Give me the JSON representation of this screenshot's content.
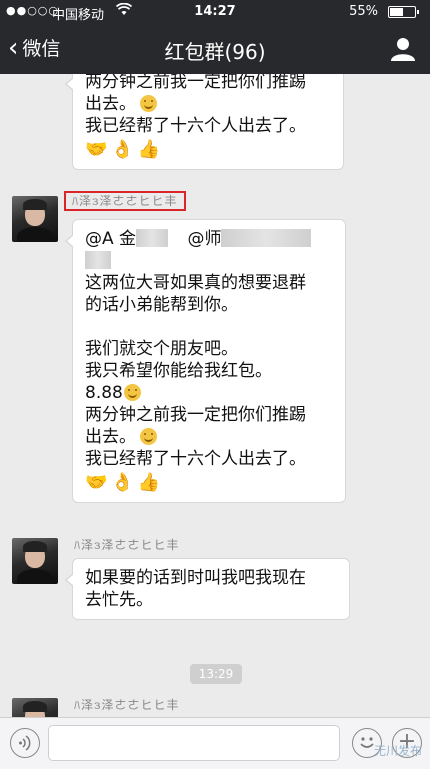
{
  "status_bar": {
    "signal": "●●○○○",
    "carrier": "中国移动",
    "time": "14:27",
    "battery_percent": "55%",
    "battery_level": 0.55
  },
  "nav": {
    "back_label": "微信",
    "title": "红包群(96)",
    "members_icon": "person-icon"
  },
  "messages": {
    "top_bubble": {
      "lines": [
        "两分钟之前我一定把你们推踢",
        "出去。",
        "我已经帮了十六个人出去了。"
      ],
      "emojis": [
        "🤝",
        "👌",
        "👍"
      ]
    },
    "sender_nickname": "ﾊ泽з泽ㄜㄜヒヒ丰",
    "main_bubble": {
      "mention_1": "@A 金",
      "mention_2": "@师",
      "lines_a": [
        "这两位大哥如果真的想要退群",
        "的话小弟能帮到你。"
      ],
      "lines_b": [
        "我们就交个朋友吧。",
        "我只希望你能给我红包。",
        "8.88"
      ],
      "lines_c": [
        "两分钟之前我一定把你们推踢",
        "出去。",
        "我已经帮了十六个人出去了。"
      ],
      "emojis": [
        "🤝",
        "👌",
        "👍"
      ]
    },
    "third_bubble": {
      "lines": [
        "如果要的话到时叫我吧我现在",
        "去忙先。"
      ]
    },
    "timestamp": "13:29"
  },
  "input_bar": {
    "watermark": "无川发布"
  }
}
